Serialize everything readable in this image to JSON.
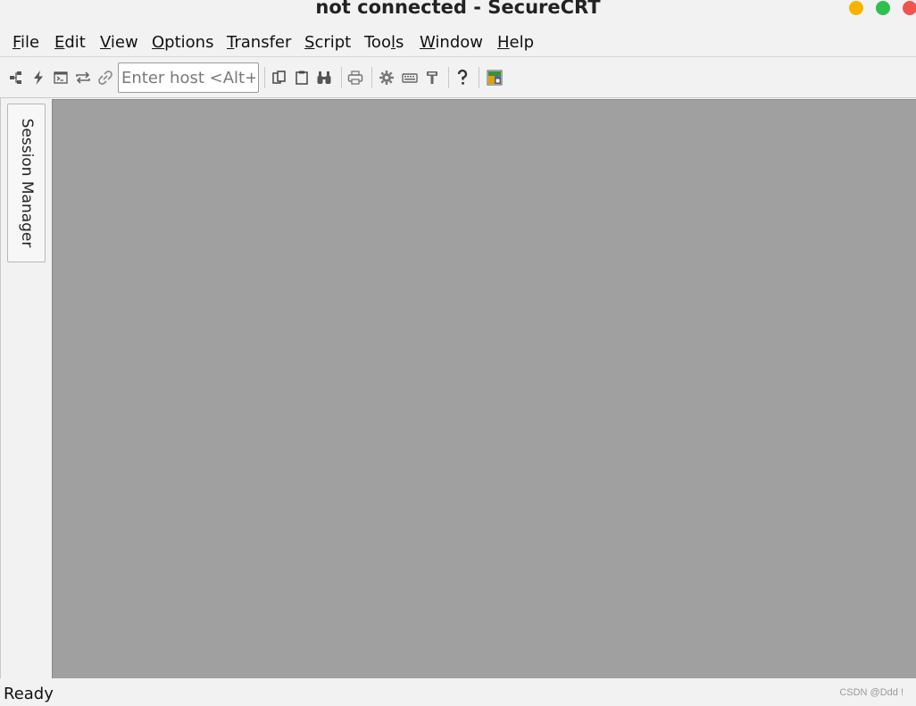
{
  "window": {
    "title": "not connected - SecureCRT",
    "controls": {
      "minimize_color": "#f6b400",
      "maximize_color": "#2fc04f",
      "close_color": "#f0544f"
    }
  },
  "menubar": {
    "items": [
      {
        "label": "File",
        "mnemonic": "F",
        "rest": "ile"
      },
      {
        "label": "Edit",
        "mnemonic": "E",
        "rest": "dit"
      },
      {
        "label": "View",
        "mnemonic": "V",
        "rest": "iew"
      },
      {
        "label": "Options",
        "mnemonic": "O",
        "rest": "ptions"
      },
      {
        "label": "Transfer",
        "mnemonic": "T",
        "rest": "ransfer"
      },
      {
        "label": "Script",
        "mnemonic": "S",
        "rest": "cript"
      },
      {
        "label": "Tools",
        "pre": "Too",
        "mnemonic": "l",
        "rest": "s"
      },
      {
        "label": "Window",
        "mnemonic": "W",
        "rest": "indow"
      },
      {
        "label": "Help",
        "mnemonic": "H",
        "rest": "elp"
      }
    ]
  },
  "toolbar": {
    "host_placeholder": "Enter host <Alt+…",
    "buttons": [
      "connect-icon",
      "quick-connect-icon",
      "connect-in-tab-icon",
      "reconnect-icon",
      "disconnect-icon",
      "copy-icon",
      "paste-icon",
      "find-icon",
      "print-icon",
      "session-options-icon",
      "keymap-editor-icon",
      "sftp-icon",
      "help-icon",
      "app-icon"
    ]
  },
  "sidebar": {
    "session_tab_label": "Session Manager"
  },
  "main": {
    "background_color": "#a0a0a0"
  },
  "statusbar": {
    "status": "Ready",
    "watermark": "CSDN @Ddd !"
  }
}
